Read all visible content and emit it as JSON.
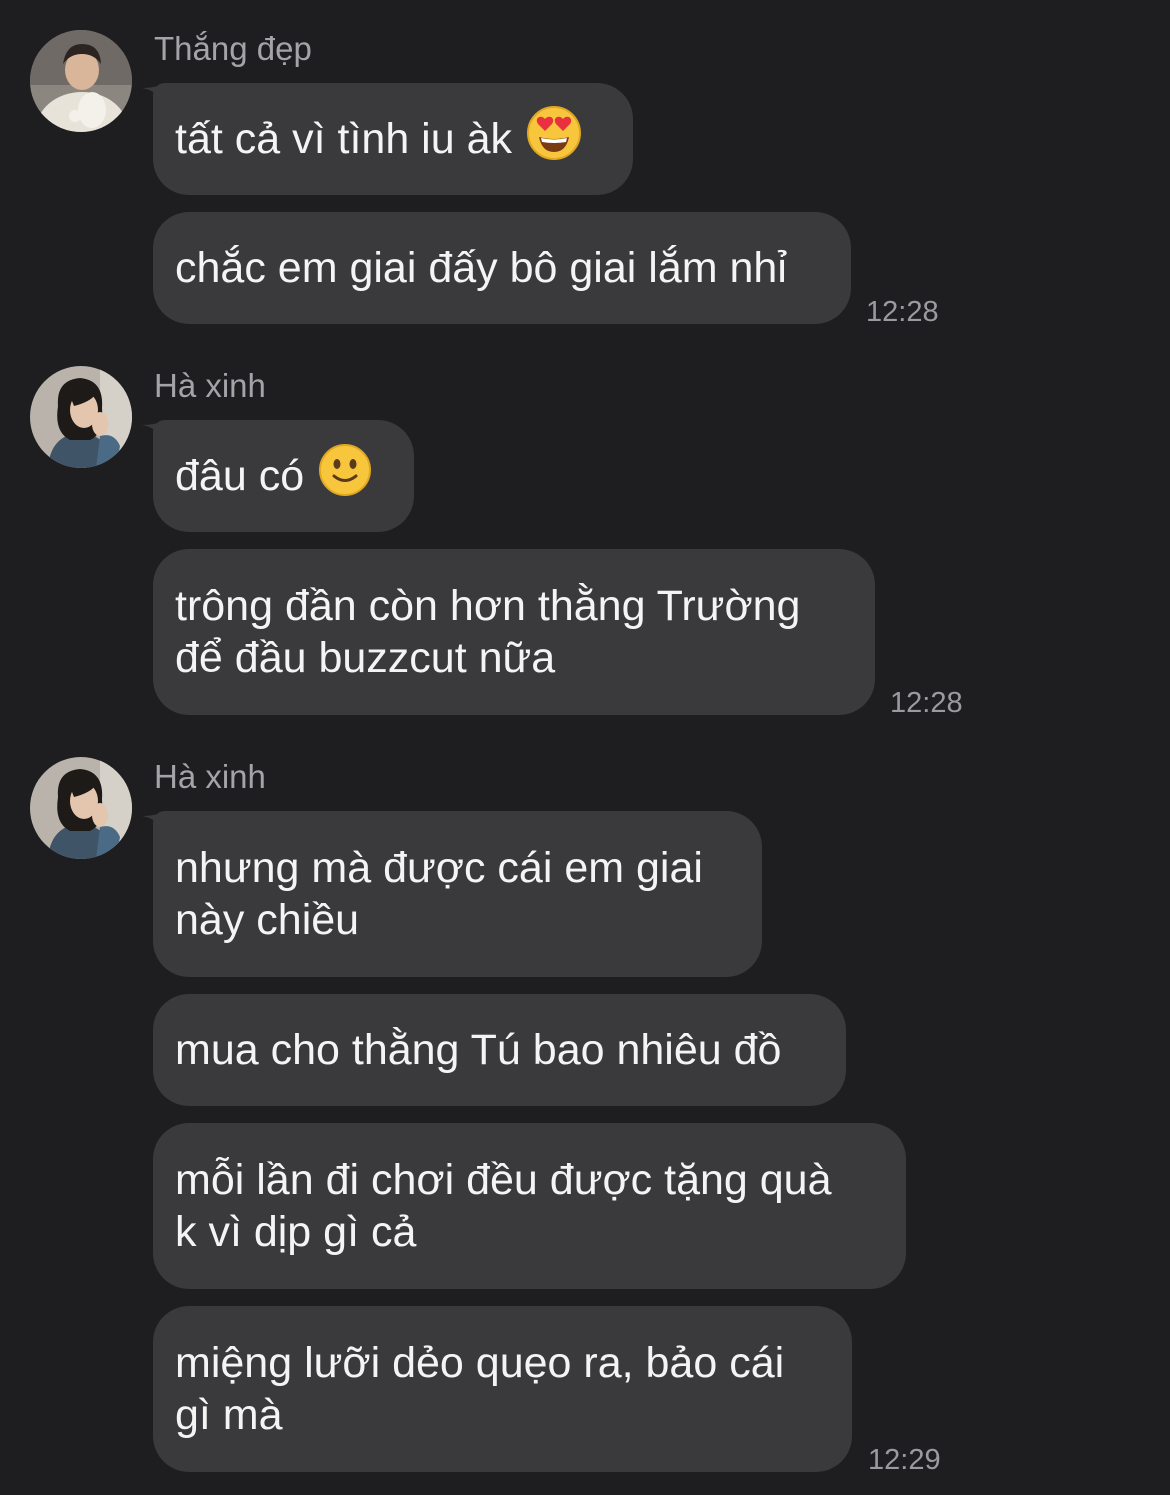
{
  "messages": [
    {
      "sender": "Thắng đẹp",
      "avatar": "avatar-thang",
      "bubbles": [
        {
          "text": "tất cả vì tình iu àk",
          "emoji": "heart-eyes-emoji"
        },
        {
          "text": "chắc em giai đấy bô giai lắm nhỉ"
        }
      ],
      "time": "12:28"
    },
    {
      "sender": "Hà xinh",
      "avatar": "avatar-ha",
      "bubbles": [
        {
          "text": "đâu có",
          "emoji": "slight-smile-emoji"
        },
        {
          "text": "trông đần còn hơn thằng Trường\nđể đầu buzzcut nữa"
        }
      ],
      "time": "12:28"
    },
    {
      "sender": "Hà xinh",
      "avatar": "avatar-ha",
      "bubbles": [
        {
          "text": "nhưng mà được cái em giai\nnày chiều"
        },
        {
          "text": "mua cho thằng Tú bao nhiêu đồ"
        },
        {
          "text": "mỗi lần đi chơi đều được tặng quà\nk vì dịp gì cả"
        },
        {
          "text": "miệng lưỡi dẻo quẹo ra, bảo cái\ngì mà"
        }
      ],
      "time": "12:29"
    }
  ],
  "colors": {
    "background": "#1e1e20",
    "bubble": "#3a3a3d",
    "sender_name": "#a3a3a8",
    "timestamp": "#9a9aa0",
    "text": "#f4f4f4"
  }
}
